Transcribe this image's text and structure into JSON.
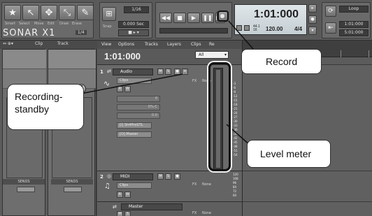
{
  "toolbar": {
    "tools": [
      "Smart",
      "Select",
      "Move",
      "Edit",
      "Draw",
      "Erase"
    ],
    "logo": "SONAR X1",
    "logo_badge": "1/4",
    "snap_value": "1/16",
    "snap_sec": "0.000 Sec",
    "snap_label": "Snap",
    "time_display": "1:01:000",
    "sample_rate_top": "44.1",
    "sample_rate_bottom": "16",
    "tempo": "120.00",
    "meter": "4/4",
    "loop_label": "Loop",
    "loop_start": "1:01:000",
    "loop_end": "5:01:000"
  },
  "inspector": {
    "tabs": [
      "Clip",
      "Track"
    ],
    "sends_labels": [
      "SENDS",
      "SENDS"
    ]
  },
  "trackview": {
    "menu": [
      "View",
      "Options",
      "Tracks",
      "Layers",
      "Clips",
      "Re"
    ],
    "now_time": "1:01:000",
    "filter": "All",
    "tracks": [
      {
        "num": "1",
        "name": "Audio",
        "fields": [
          "Clips",
          "0",
          "0%-C",
          "0.0",
          "[I] Sh4ProSTL",
          "[O] Master"
        ],
        "fx_label": "FX",
        "fx_value": "None",
        "meter_scale": [
          "-3",
          "-6",
          "-9",
          "-12",
          "-15",
          "-18",
          "-21",
          "-24",
          "-27",
          "-30",
          "-33",
          "-36",
          "-39",
          "-42",
          "-45",
          "-48",
          "-51",
          "-54"
        ]
      },
      {
        "num": "2",
        "name": "MIDI",
        "fields": [
          "Clips",
          "Master"
        ],
        "fx_label": "FX",
        "fx_value": "None",
        "meter_scale": [
          "120",
          "108",
          "96",
          "84",
          "72",
          "60"
        ]
      },
      {
        "name": "Master",
        "fx_label": "FX",
        "fx_value": "None"
      }
    ]
  },
  "callouts": {
    "record": "Record",
    "recording_standby": "Recording-\nstandby",
    "level_meter": "Level meter"
  }
}
